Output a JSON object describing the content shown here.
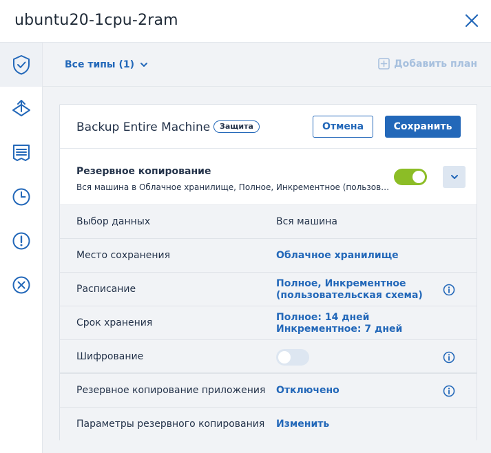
{
  "window": {
    "title": "ubuntu20-1cpu-2ram",
    "close_icon": "close-icon"
  },
  "sidebar": {
    "items": [
      {
        "name": "protection",
        "icon": "shield-check-icon",
        "active": true
      },
      {
        "name": "recovery",
        "icon": "recovery-icon",
        "active": false
      },
      {
        "name": "activities",
        "icon": "list-icon",
        "active": false
      },
      {
        "name": "history",
        "icon": "clock-icon",
        "active": false
      },
      {
        "name": "alerts",
        "icon": "alert-icon",
        "active": false
      },
      {
        "name": "remove",
        "icon": "x-circle-icon",
        "active": false
      }
    ]
  },
  "toolbar": {
    "filter_label": "Все типы (1)",
    "add_plan_label": "Добавить план"
  },
  "plan": {
    "name": "Backup Entire Machine",
    "badge": "Защита",
    "cancel_label": "Отмена",
    "save_label": "Сохранить",
    "backup": {
      "title": "Резервное копирование",
      "description": "Вся машина в Облачное хранилище, Полное, Инкрементное (пользовательская схема)",
      "enabled": true
    },
    "rows": [
      {
        "label": "Выбор данных",
        "value": "Вся машина"
      },
      {
        "label": "Место сохранения",
        "value": "Облачное хранилище"
      },
      {
        "label": "Расписание",
        "value_line1": "Полное, Инкрементное",
        "value_line2": "(пользовательская схема)"
      },
      {
        "label": "Срок хранения",
        "value_line1": "Полное: 14 дней",
        "value_line2": "Инкрементное: 7 дней"
      },
      {
        "label": "Шифрование",
        "enabled": false
      },
      {
        "label": "Резервное копирование приложения",
        "value": "Отключено"
      },
      {
        "label": "Параметры резервного копирования",
        "value": "Изменить"
      }
    ]
  },
  "colors": {
    "accent": "#2368b9",
    "toggle_on": "#8cbd26",
    "background": "#f1f3f6"
  }
}
